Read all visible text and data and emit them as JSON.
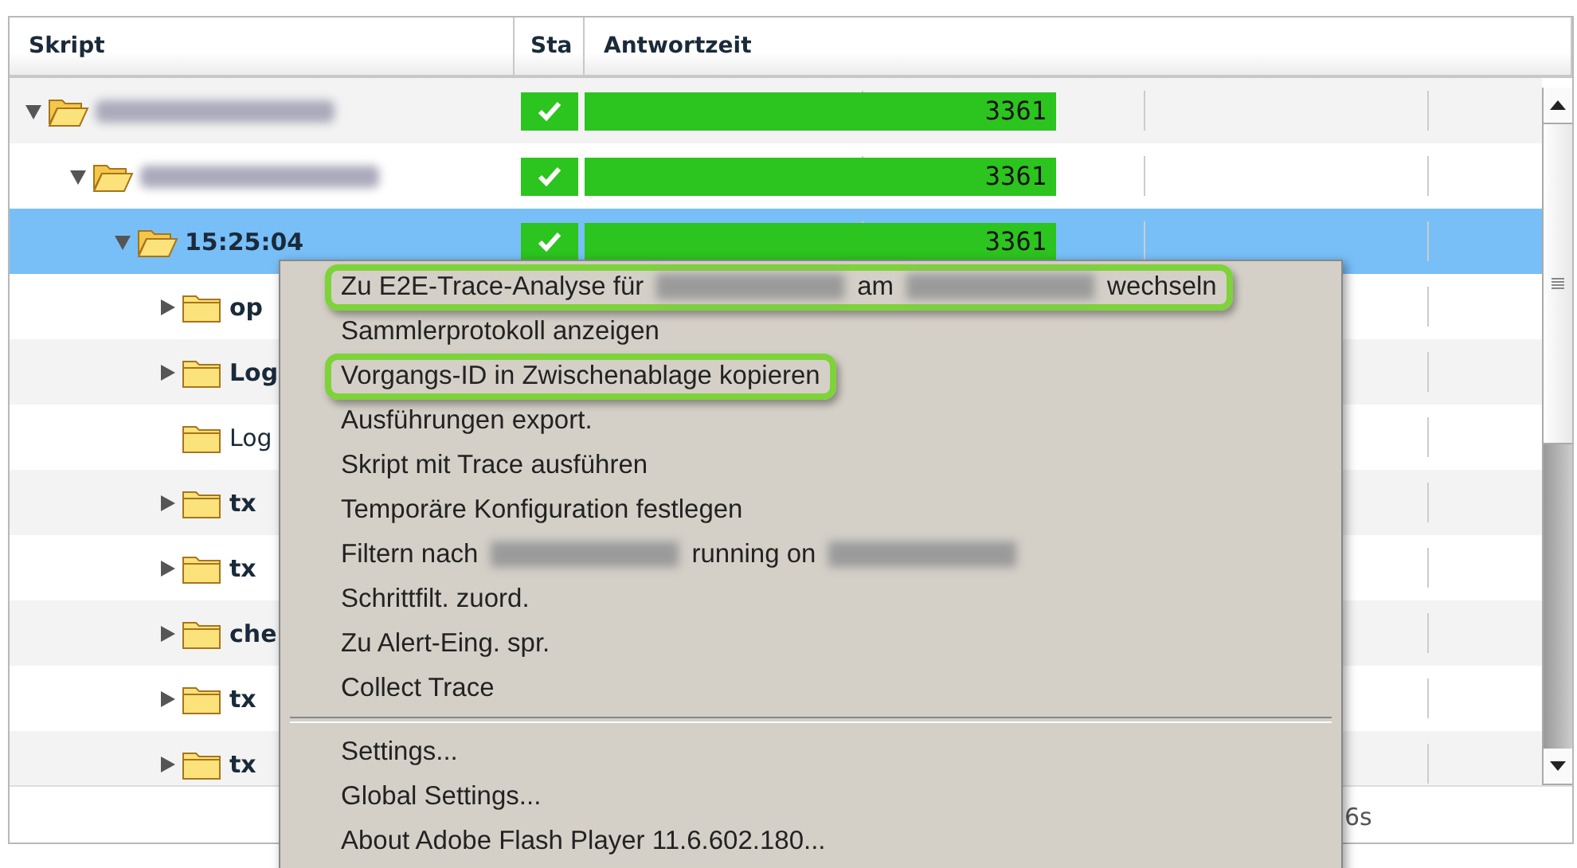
{
  "table": {
    "columns": [
      "Skript",
      "Sta",
      "Antwortzeit"
    ],
    "rows": [
      {
        "expanded": true,
        "selected": false,
        "passed": true,
        "time": "3361",
        "level": 0.49,
        "children": [
          {
            "expanded": true,
            "selected": false,
            "passed": true,
            "time": "3361",
            "level": 0.49,
            "children": [
              {
                "label": "15:25:04",
                "bold": true,
                "expanded": true,
                "selected": true,
                "passed": true,
                "time": "3361",
                "level": 0.49,
                "children": [
                  {
                    "label": "op",
                    "expanded": false,
                    "selected": false,
                    "bold": true
                  },
                  {
                    "label": "Log",
                    "expanded": false,
                    "selected": false,
                    "bold": true
                  },
                  {
                    "label": "Log",
                    "selected": false,
                    "bold": false
                  },
                  {
                    "label": "tx",
                    "expanded": false,
                    "selected": false,
                    "bold": true
                  },
                  {
                    "label": "tx",
                    "expanded": false,
                    "selected": false,
                    "bold": true
                  },
                  {
                    "label": "che",
                    "expanded": false,
                    "selected": false,
                    "bold": true
                  },
                  {
                    "label": "tx",
                    "expanded": false,
                    "selected": false,
                    "bold": true
                  },
                  {
                    "label": "tx",
                    "expanded": false,
                    "selected": false,
                    "bold": true
                  }
                ]
              }
            ]
          }
        ]
      }
    ],
    "footer": {
      "column_4": "6s"
    }
  },
  "context_menu": {
    "groups": [
      [
        {
          "highlighted": true,
          "parts": [
            {
              "kind": "text",
              "text": "Zu E2E-Trace-Analyse für"
            },
            {
              "kind": "redacted"
            },
            {
              "kind": "text",
              "text": "am"
            },
            {
              "kind": "redacted"
            },
            {
              "kind": "text",
              "text": "wechseln"
            }
          ]
        },
        {
          "highlighted": false,
          "parts": [
            {
              "kind": "text",
              "text": "Sammlerprotokoll anzeigen"
            }
          ]
        },
        {
          "highlighted": true,
          "parts": [
            {
              "kind": "text",
              "text": "Vorgangs-ID in Zwischenablage kopieren"
            }
          ]
        },
        {
          "highlighted": false,
          "parts": [
            {
              "kind": "text",
              "text": "Ausführungen export."
            }
          ]
        },
        {
          "highlighted": false,
          "parts": [
            {
              "kind": "text",
              "text": "Skript mit Trace ausführen"
            }
          ]
        },
        {
          "highlighted": false,
          "parts": [
            {
              "kind": "text",
              "text": "Temporäre Konfiguration festlegen"
            }
          ]
        },
        {
          "highlighted": false,
          "parts": [
            {
              "kind": "text",
              "text": "Filtern nach"
            },
            {
              "kind": "redacted"
            },
            {
              "kind": "text",
              "text": "running on"
            },
            {
              "kind": "redacted"
            }
          ]
        },
        {
          "highlighted": false,
          "parts": [
            {
              "kind": "text",
              "text": "Schrittfilt. zuord."
            }
          ]
        },
        {
          "highlighted": false,
          "parts": [
            {
              "kind": "text",
              "text": "Zu Alert-Eing. spr."
            }
          ]
        },
        {
          "highlighted": false,
          "parts": [
            {
              "kind": "text",
              "text": "Collect Trace"
            }
          ]
        }
      ],
      [
        {
          "highlighted": false,
          "parts": [
            {
              "kind": "text",
              "text": "Settings..."
            }
          ]
        },
        {
          "highlighted": false,
          "parts": [
            {
              "kind": "text",
              "text": "Global Settings..."
            }
          ]
        },
        {
          "highlighted": false,
          "parts": [
            {
              "kind": "text",
              "text": "About Adobe Flash Player 11.6.602.180..."
            }
          ]
        }
      ]
    ]
  }
}
